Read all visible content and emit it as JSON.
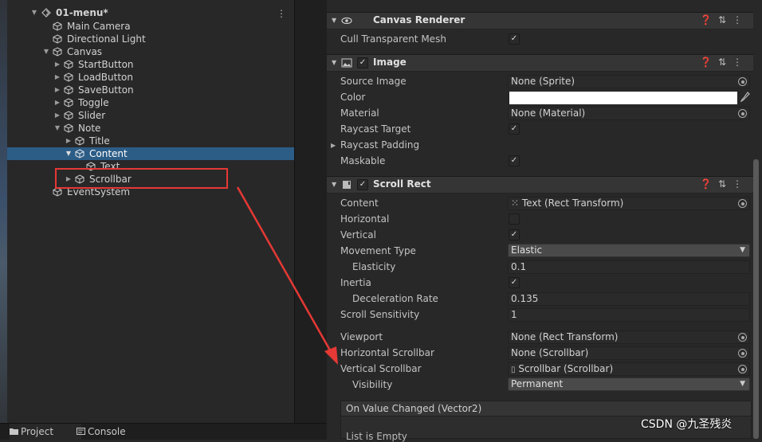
{
  "hierarchy": {
    "scene_name": "01-menu*",
    "items": [
      {
        "label": "Main Camera"
      },
      {
        "label": "Directional Light"
      },
      {
        "label": "Canvas"
      },
      {
        "label": "StartButton"
      },
      {
        "label": "LoadButton"
      },
      {
        "label": "SaveButton"
      },
      {
        "label": "Toggle"
      },
      {
        "label": "Slider"
      },
      {
        "label": "Note"
      },
      {
        "label": "Title"
      },
      {
        "label": "Content"
      },
      {
        "label": "Text"
      },
      {
        "label": "Scrollbar"
      },
      {
        "label": "EventSystem"
      }
    ],
    "selected": "Content",
    "highlighted_item": "Scrollbar"
  },
  "bottom_tabs": {
    "project": "Project",
    "console": "Console"
  },
  "inspector": {
    "canvas_renderer": {
      "title": "Canvas Renderer",
      "cull_label": "Cull Transparent Mesh",
      "cull_checked": true
    },
    "image": {
      "title": "Image",
      "source_image_label": "Source Image",
      "source_image_value": "None (Sprite)",
      "color_label": "Color",
      "color_value": "#ffffff",
      "material_label": "Material",
      "material_value": "None (Material)",
      "raycast_target_label": "Raycast Target",
      "raycast_padding_label": "Raycast Padding",
      "maskable_label": "Maskable"
    },
    "scroll_rect": {
      "title": "Scroll Rect",
      "content_label": "Content",
      "content_value": "Text (Rect Transform)",
      "horizontal_label": "Horizontal",
      "vertical_label": "Vertical",
      "movement_type_label": "Movement Type",
      "movement_type_value": "Elastic",
      "elasticity_label": "Elasticity",
      "elasticity_value": "0.1",
      "inertia_label": "Inertia",
      "deceleration_label": "Deceleration Rate",
      "deceleration_value": "0.135",
      "sensitivity_label": "Scroll Sensitivity",
      "sensitivity_value": "1",
      "viewport_label": "Viewport",
      "viewport_value": "None (Rect Transform)",
      "hscroll_label": "Horizontal Scrollbar",
      "hscroll_value": "None (Scrollbar)",
      "vscroll_label": "Vertical Scrollbar",
      "vscroll_value": "Scrollbar (Scrollbar)",
      "visibility_label": "Visibility",
      "visibility_value": "Permanent",
      "event_label": "On Value Changed (Vector2)",
      "event_empty": "List is Empty"
    }
  },
  "watermark": "CSDN @九圣残炎",
  "colors": {
    "selection": "#2c5d87",
    "annotation_red": "#e53935",
    "panel_bg": "#282828",
    "header_bg": "#353535"
  }
}
